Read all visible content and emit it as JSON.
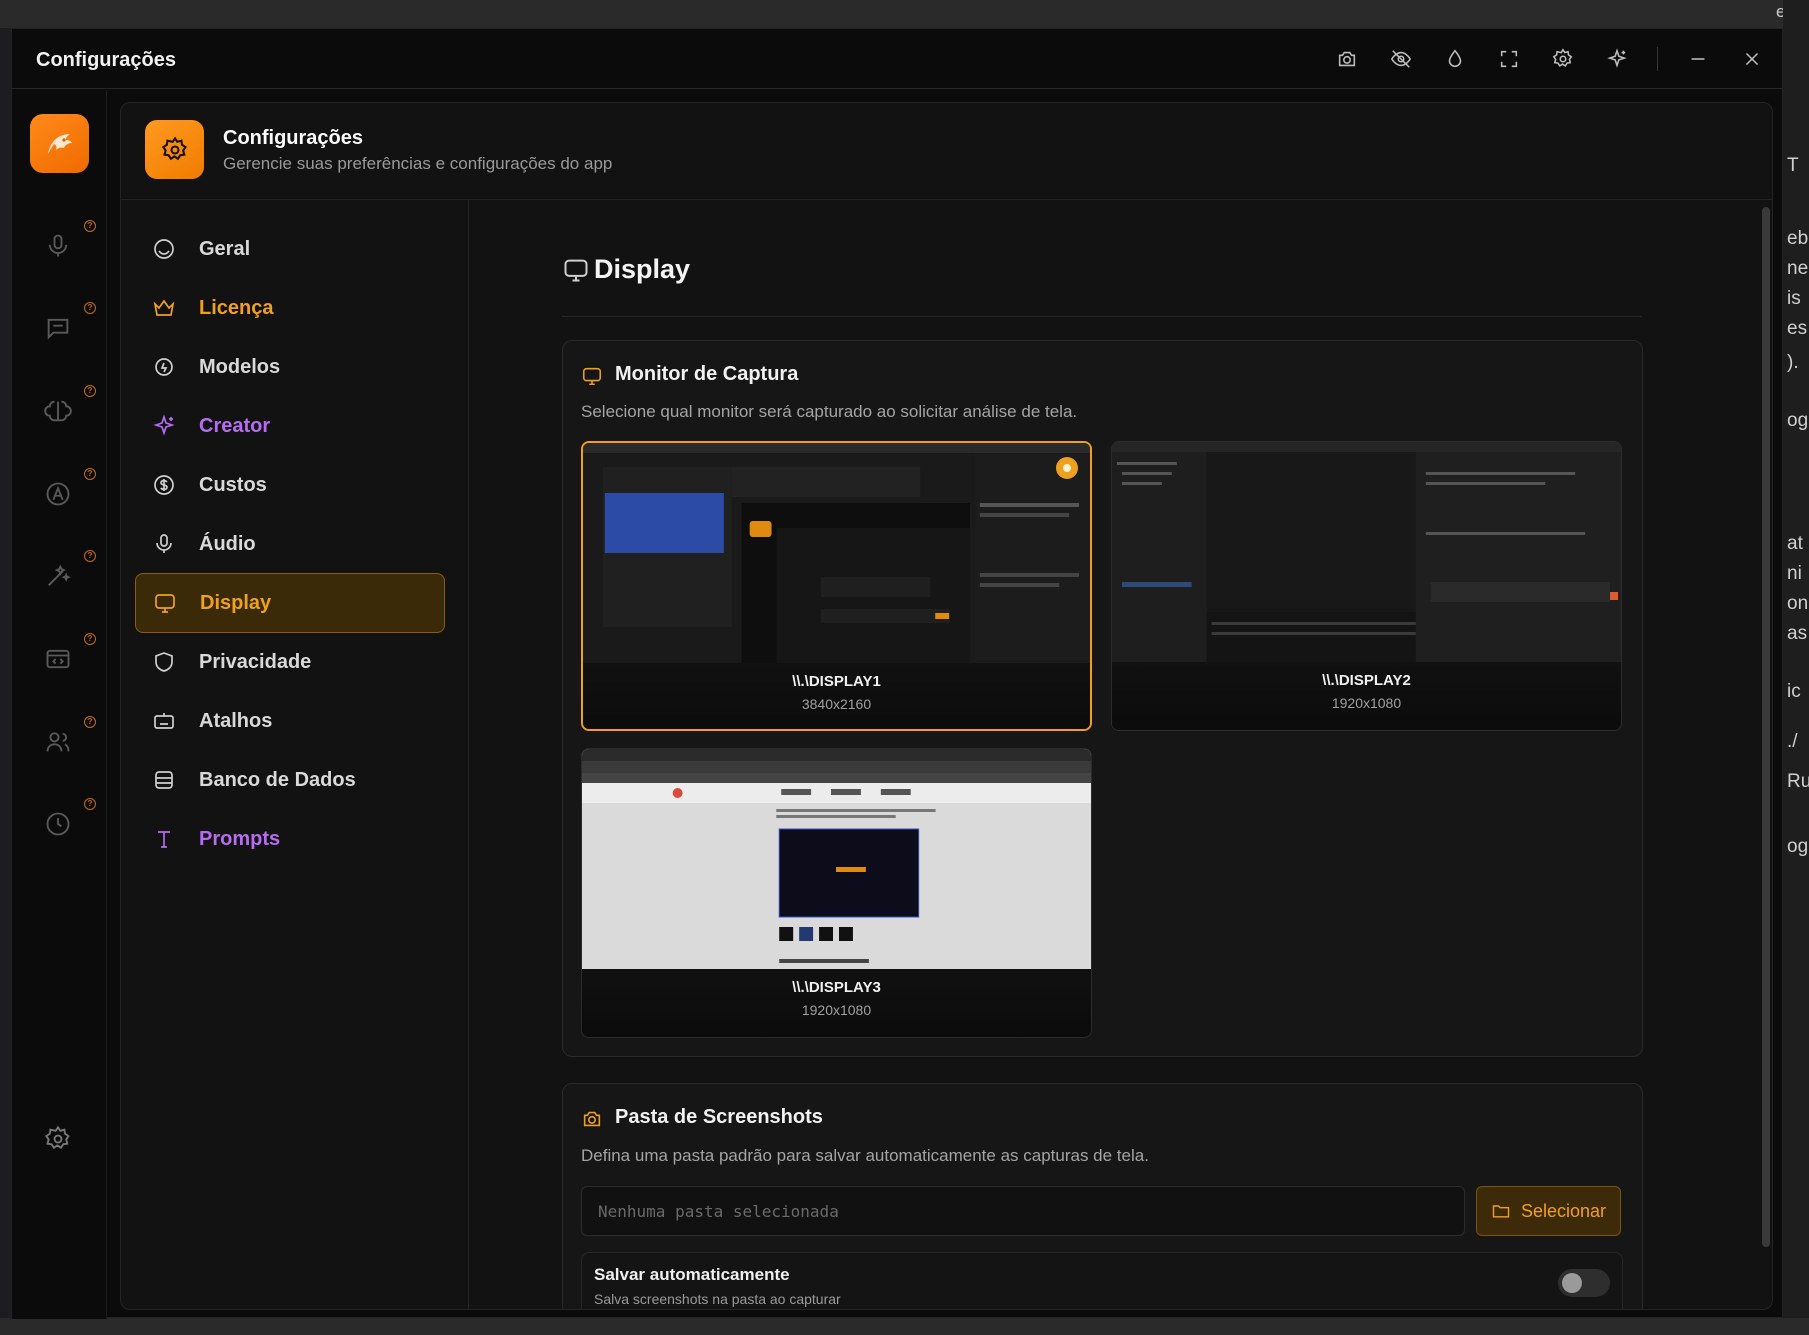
{
  "window": {
    "title": "Configurações"
  },
  "header": {
    "title": "Configurações",
    "subtitle": "Gerencie suas preferências e configurações do app"
  },
  "nav": {
    "items": [
      {
        "label": "Geral",
        "color": "#d9d9d9"
      },
      {
        "label": "Licença",
        "color": "#f0a020"
      },
      {
        "label": "Modelos",
        "color": "#d9d9d9"
      },
      {
        "label": "Creator",
        "color": "#b56cf0"
      },
      {
        "label": "Custos",
        "color": "#d9d9d9"
      },
      {
        "label": "Áudio",
        "color": "#d9d9d9"
      },
      {
        "label": "Display",
        "color": "#f0a020"
      },
      {
        "label": "Privacidade",
        "color": "#d9d9d9"
      },
      {
        "label": "Atalhos",
        "color": "#d9d9d9"
      },
      {
        "label": "Banco de Dados",
        "color": "#d9d9d9"
      },
      {
        "label": "Prompts",
        "color": "#b56cf0"
      }
    ],
    "active": "Display"
  },
  "section": {
    "title": "Display"
  },
  "capture": {
    "title": "Monitor de Captura",
    "description": "Selecione qual monitor será capturado ao solicitar análise de tela.",
    "monitors": [
      {
        "name": "\\\\.\\DISPLAY1",
        "resolution": "3840x2160",
        "selected": true
      },
      {
        "name": "\\\\.\\DISPLAY2",
        "resolution": "1920x1080",
        "selected": false
      },
      {
        "name": "\\\\.\\DISPLAY3",
        "resolution": "1920x1080",
        "selected": false
      }
    ]
  },
  "screenshots": {
    "title": "Pasta de Screenshots",
    "description": "Defina uma pasta padrão para salvar automaticamente as capturas de tela.",
    "folder_placeholder": "Nenhuma pasta selecionada",
    "folder_value": "",
    "select_label": "Selecionar",
    "auto_save": {
      "title": "Salvar automaticamente",
      "subtitle": "Salva screenshots na pasta ao capturar",
      "enabled": false
    }
  },
  "accent": "#f0a020",
  "background_fragments": [
    "en",
    "T",
    "eb",
    "ne",
    "is",
    "es",
    ").",
    "og",
    "at",
    "ni",
    "on",
    "as",
    "ic",
    "./",
    "Ru",
    "og"
  ]
}
